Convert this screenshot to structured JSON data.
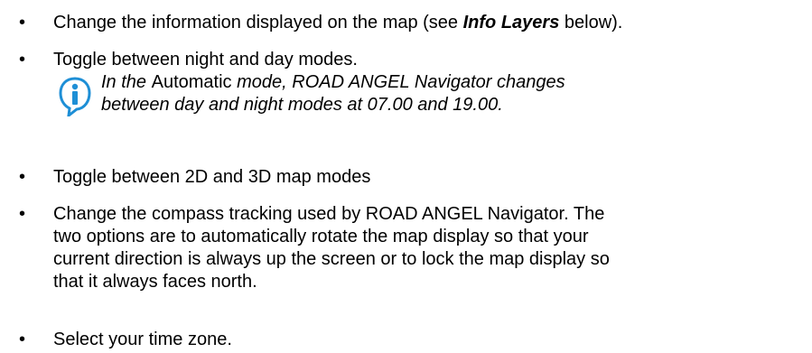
{
  "bullet_glyph": "•",
  "items": [
    {
      "before": "Change the information displayed on the map (see ",
      "emphasis": "Info Layers",
      "after": " below)."
    },
    {
      "text": "Toggle between night and day modes."
    },
    {
      "text": "Toggle between 2D and 3D map modes"
    },
    {
      "lines": [
        "Change the compass tracking used by ROAD ANGEL Navigator. The",
        "two options are to automatically rotate the map display so that your",
        "current direction is always up the screen or to lock the map display so",
        "that it always faces north."
      ]
    },
    {
      "text": "Select your time zone."
    }
  ],
  "note": {
    "icon": "info-icon",
    "icon_color": "#1e8fd6",
    "line1_before": "In the ",
    "line1_upright": "Automatic",
    "line1_after": " mode, ROAD ANGEL Navigator changes",
    "line2": "between day and night modes at 07.00 and 19.00."
  }
}
